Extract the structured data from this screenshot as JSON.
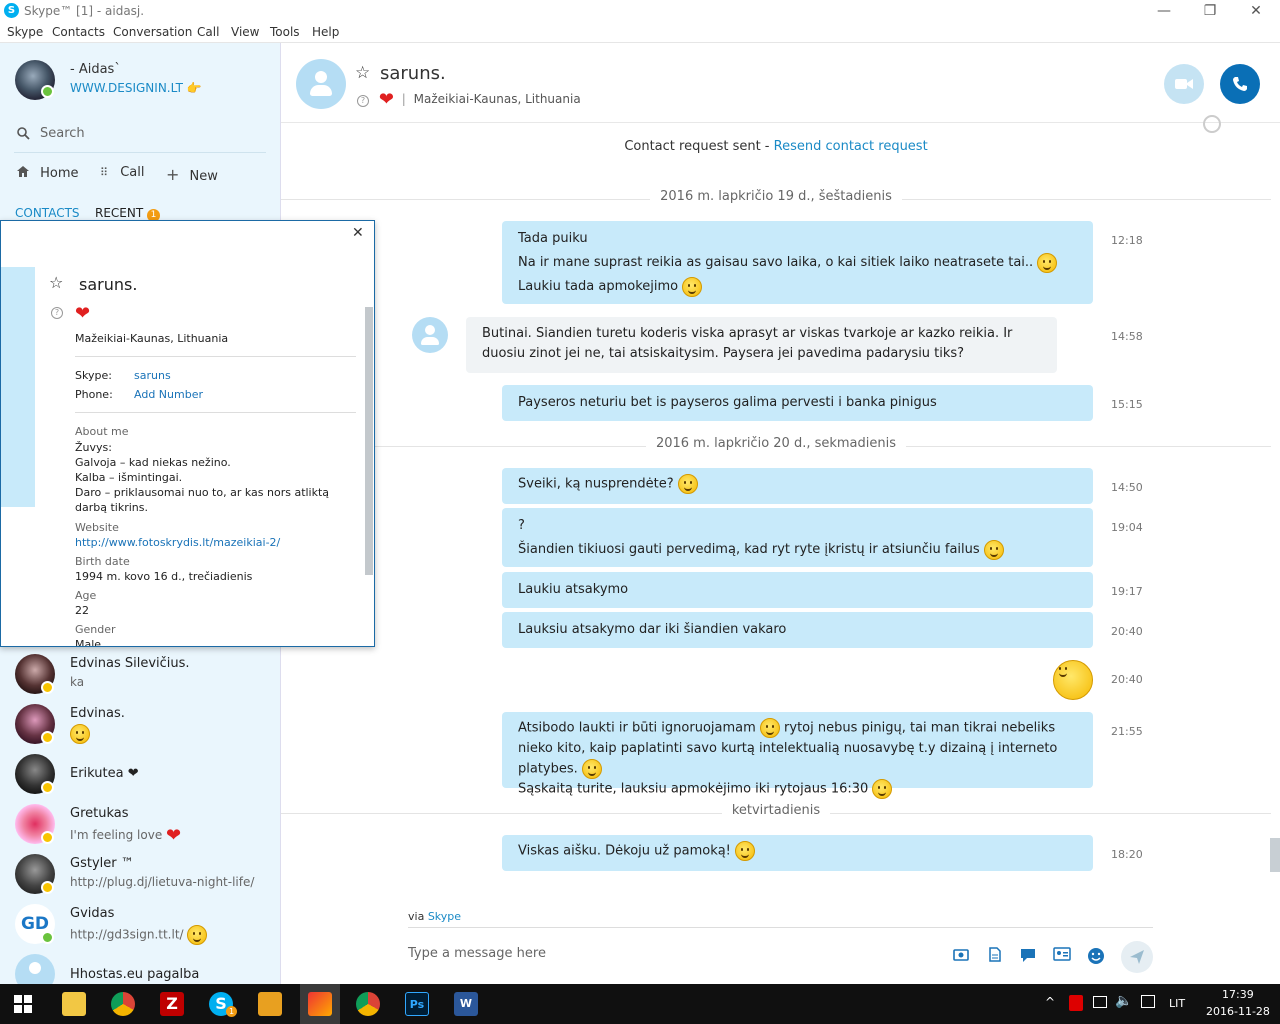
{
  "window": {
    "title": "Skype™ [1] - aidasj.",
    "logo": "S",
    "minimize": "—",
    "restore": "❐",
    "close": "✕"
  },
  "menu": [
    "Skype",
    "Contacts",
    "Conversation",
    "Call",
    "View",
    "Tools",
    "Help"
  ],
  "me": {
    "name": "- Aidas`",
    "mood": "WWW.DESIGNIN.LT",
    "mood_icon": "👉"
  },
  "search": {
    "placeholder": "Search"
  },
  "nav": {
    "home": "Home",
    "call": "Call",
    "new": "New"
  },
  "tabs": {
    "contacts": "CONTACTS",
    "recent": "RECENT",
    "recent_badge": "1"
  },
  "contacts": [
    {
      "name": "Edvinas Silevičius.",
      "mood": "ka",
      "status": "away"
    },
    {
      "name": "Edvinas.",
      "mood": "",
      "status": "away",
      "mood_smiley": true
    },
    {
      "name": "Erikutea ❤",
      "mood": "",
      "status": "away"
    },
    {
      "name": "Gretukas",
      "mood": "I'm feeling love",
      "status": "away",
      "mood_heart": true
    },
    {
      "name": "Gstyler ™",
      "mood": "http://plug.dj/lietuva-night-life/",
      "status": "away"
    },
    {
      "name": "Gvidas",
      "mood": "http://gd3sign.tt.lt/",
      "status": "online",
      "mood_smiley": true,
      "avatar_text": "GD"
    },
    {
      "name": "Hhostas.eu pagalba",
      "mood": "",
      "status": "none"
    }
  ],
  "conversation": {
    "name": "saruns.",
    "location": "Mažeikiai-Kaunas, Lithuania",
    "separator": "|",
    "notice_text": "Contact request sent - ",
    "notice_link": "Resend contact request"
  },
  "dates": {
    "d1": "2016 m. lapkričio 19 d., šeštadienis",
    "d2": "2016 m. lapkričio 20 d., sekmadienis",
    "d3": "ketvirtadienis"
  },
  "messages": {
    "m1_l1": "Tada puiku",
    "m1_l2": "Na ir mane suprast reikia as gaisau savo laika, o kai sitiek laiko neatrasete tai..",
    "m1_l3": "Laukiu tada apmokejimo",
    "m1_time": "12:18",
    "m2": "Butinai. Siandien turetu koderis viska aprasyt ar viskas tvarkoje ar kazko reikia. Ir duosiu zinot jei ne, tai atsiskaitysim. Paysera jei pavedima padarysiu tiks?",
    "m2_time": "14:58",
    "m3": "Payseros neturiu bet is payseros galima pervesti i banka pinigus",
    "m3_time": "15:15",
    "m4": "Sveiki, ką nusprendėte?",
    "m4_time": "14:50",
    "m5_l1": "?",
    "m5_l2": "Šiandien tikiuosi gauti pervedimą, kad ryt ryte įkristų ir atsiunčiu failus",
    "m5_time": "19:04",
    "m6": "Laukiu atsakymo",
    "m6_time": "19:17",
    "m7": "Lauksiu atsakymo dar iki šiandien vakaro",
    "m7_time": "20:40",
    "m8_time": "20:40",
    "m9_a": "Atsibodo laukti ir būti ignoruojamam",
    "m9_b": "rytoj nebus pinigų, tai man tikrai nebeliks nieko kito, kaip paplatinti savo kurtą intelektualią nuosavybę t.y dizainą į interneto platybes.",
    "m9_c": "Sąskaitą turite, lauksiu apmokėjimo iki rytojaus 16:30",
    "m9_time": "21:55",
    "m10": "Viskas aišku. Dėkoju už pamoką!",
    "m10_time": "18:20"
  },
  "composer": {
    "via": "via ",
    "via_link": "Skype",
    "placeholder": "Type a message here"
  },
  "profile": {
    "name": "saruns.",
    "location": "Mažeikiai-Kaunas, Lithuania",
    "skype_label": "Skype:",
    "skype_value": "saruns",
    "phone_label": "Phone:",
    "phone_value": "Add Number",
    "about_label": "About me",
    "about_lines": [
      "Žuvys:",
      "Galvoja – kad niekas nežino.",
      "Kalba – išmintingai.",
      "Daro – priklausomai nuo to, ar kas nors atliktą darbą tikrins."
    ],
    "website_label": "Website",
    "website_value": "http://www.fotoskrydis.lt/mazeikiai-2/",
    "birth_label": "Birth date",
    "birth_value": "1994 m. kovo 16 d., trečiadienis",
    "age_label": "Age",
    "age_value": "22",
    "gender_label": "Gender",
    "gender_value": "Male",
    "close": "✕"
  },
  "taskbar": {
    "lang": "LIT",
    "time": "17:39",
    "date": "2016-11-28",
    "skype_badge": "1"
  },
  "colors": {
    "accent": "#0078d4",
    "bubble_out": "#c8eafa",
    "bubble_in": "#f0f3f5",
    "sidebar": "#eaf6fd",
    "link": "#1a8ac6"
  }
}
